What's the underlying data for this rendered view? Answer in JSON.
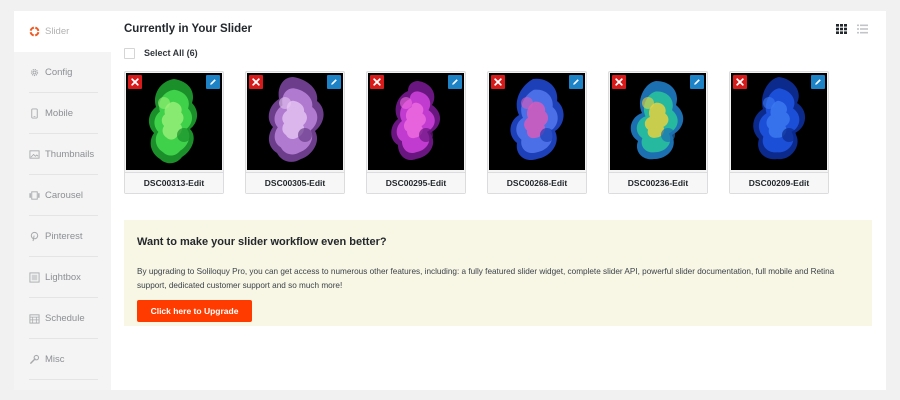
{
  "sidebar": {
    "items": [
      {
        "label": "Slider",
        "icon": "lifebuoy-icon",
        "active": true
      },
      {
        "label": "Config",
        "icon": "gear-icon"
      },
      {
        "label": "Mobile",
        "icon": "mobile-icon"
      },
      {
        "label": "Thumbnails",
        "icon": "image-icon"
      },
      {
        "label": "Carousel",
        "icon": "carousel-icon"
      },
      {
        "label": "Pinterest",
        "icon": "pinterest-icon"
      },
      {
        "label": "Lightbox",
        "icon": "lightbox-icon"
      },
      {
        "label": "Schedule",
        "icon": "calendar-icon"
      },
      {
        "label": "Misc",
        "icon": "wrench-icon"
      }
    ]
  },
  "main": {
    "title": "Currently in Your Slider",
    "select_all_label": "Select All (6)",
    "view_modes": [
      "grid-view-icon",
      "list-view-icon"
    ]
  },
  "slides": [
    {
      "title": "DSC00313-Edit",
      "colors": [
        "#1a8f2a",
        "#3fd14a",
        "#9cf07a"
      ]
    },
    {
      "title": "DSC00305-Edit",
      "colors": [
        "#6b3d8a",
        "#b07ad0",
        "#e6c6f2"
      ]
    },
    {
      "title": "DSC00295-Edit",
      "colors": [
        "#6a1680",
        "#c23bd0",
        "#f06de0"
      ]
    },
    {
      "title": "DSC00268-Edit",
      "colors": [
        "#1d3fb8",
        "#4b6fe6",
        "#e05ab8"
      ]
    },
    {
      "title": "DSC00236-Edit",
      "colors": [
        "#1c6fb0",
        "#27b8a0",
        "#f2d23a"
      ]
    },
    {
      "title": "DSC00209-Edit",
      "colors": [
        "#0c2a8c",
        "#1c4fd8",
        "#3c7af0"
      ]
    }
  ],
  "upsell": {
    "heading": "Want to make your slider workflow even better?",
    "body": "By upgrading to Soliloquy Pro, you can get access to numerous other features, including: a fully featured slider widget, complete slider API, powerful slider documentation, full mobile and Retina support, dedicated customer support and so much more!",
    "button_label": "Click here to Upgrade"
  },
  "colors": {
    "accent": "#ff3b00",
    "remove": "#d91a1a",
    "edit": "#1e83c6",
    "upsell_bg": "#f8f6e4"
  }
}
